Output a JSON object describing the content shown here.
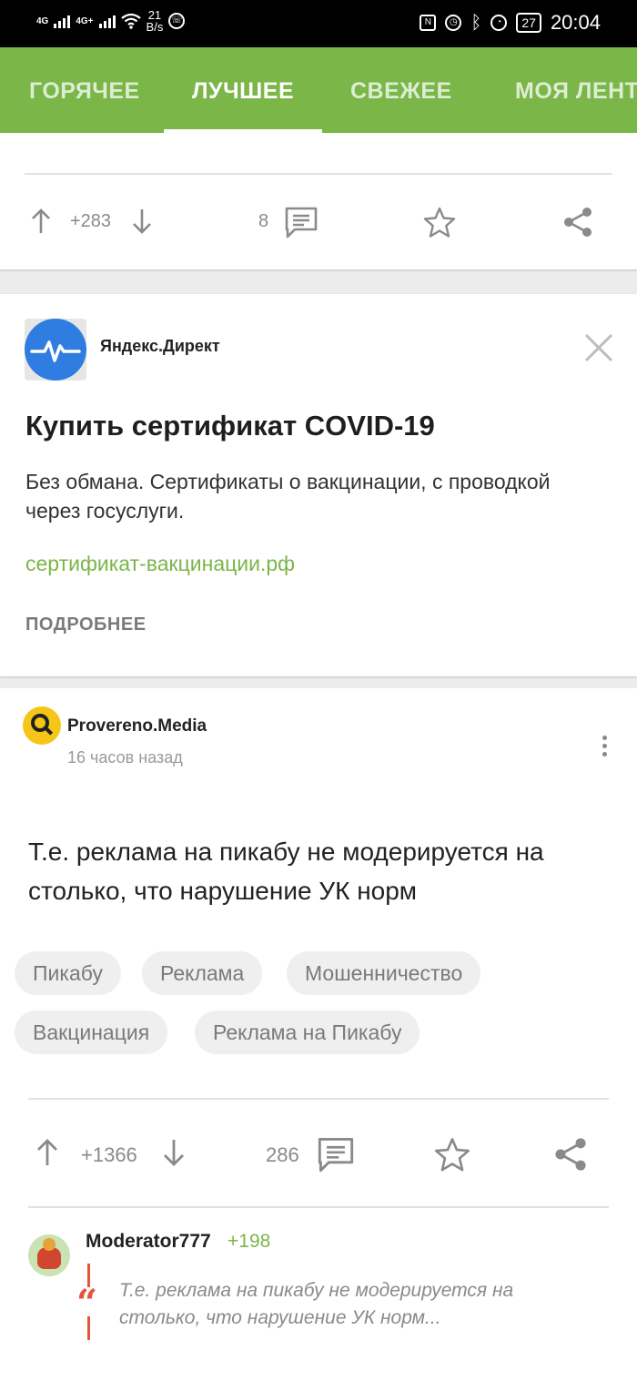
{
  "status_bar": {
    "signal_1": "4G",
    "signal_2": "4G+",
    "net_speed_value": "21",
    "net_speed_unit": "B/s",
    "battery": "27",
    "time": "20:04"
  },
  "tabs": [
    {
      "label": "ГОРЯЧЕЕ",
      "active": false
    },
    {
      "label": "ЛУЧШЕЕ",
      "active": true
    },
    {
      "label": "СВЕЖЕЕ",
      "active": false
    },
    {
      "label": "МОЯ ЛЕНТА",
      "active": false
    }
  ],
  "prev_post": {
    "rating": "+283",
    "comments": "8"
  },
  "ad": {
    "source": "Яндекс.Директ",
    "title": "Купить сертификат COVID-19",
    "description": "Без обмана. Сертификаты о вакцинации, с проводкой через госуслуги.",
    "link": "сертификат-вакцинации.рф",
    "more": "ПОДРОБНЕЕ"
  },
  "post": {
    "author": "Provereno.Media",
    "time": "16 часов назад",
    "text": "Т.е. реклама на пикабу не модерируется на столько, что нарушение УК норм",
    "tags": [
      "Пикабу",
      "Реклама",
      "Мошенничество",
      "Вакцинация",
      "Реклама на Пикабу"
    ],
    "rating": "+1366",
    "comments": "286"
  },
  "comment": {
    "author": "Moderator777",
    "score": "+198",
    "quote": "Т.е. реклама на пикабу не модерируется на столько, что нарушение УК норм..."
  },
  "colors": {
    "accent": "#7ab648",
    "quote": "#e4553b",
    "ad_logo": "#2f7de1"
  }
}
